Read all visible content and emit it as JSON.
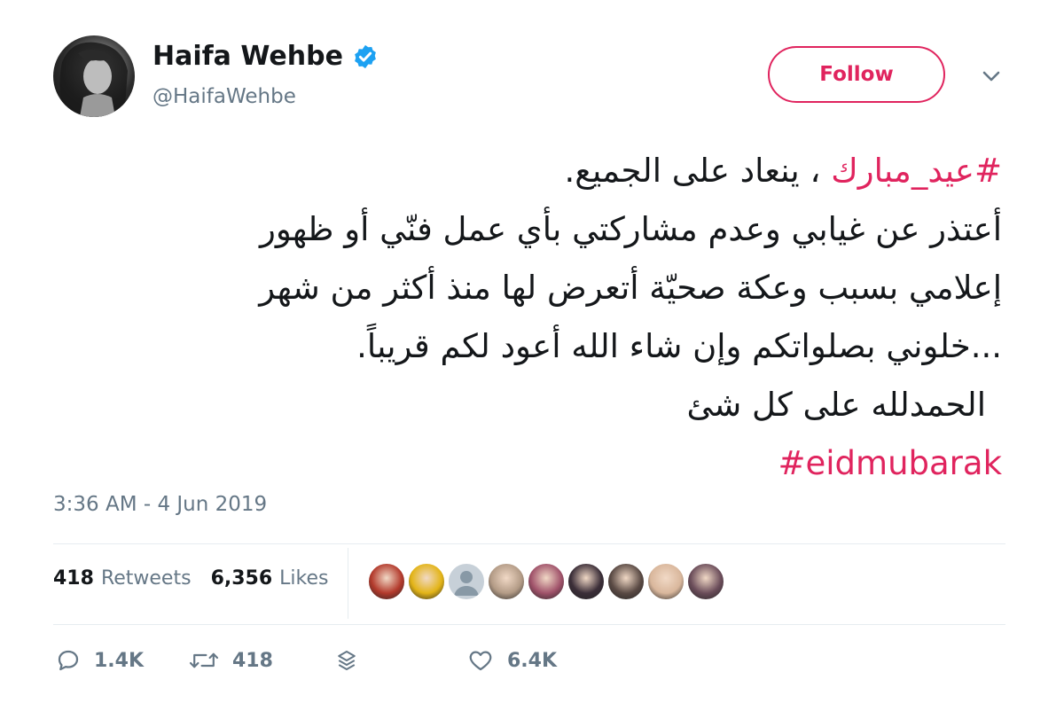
{
  "user": {
    "name": "Haifa Wehbe",
    "handle": "@HaifaWehbe"
  },
  "follow_label": "Follow",
  "tweet": {
    "lines": [
      {
        "hashtag": "#عيد_مبارك",
        "text": " ، ينعاد على الجميع."
      },
      {
        "text": "أعتذر عن غيابي وعدم مشاركتي بأي عمل فنّي أو ظهور"
      },
      {
        "text": "إعلامي بسبب وعكة صحيّة أتعرض لها منذ أكثر من شهر"
      },
      {
        "text": "...خلوني بصلواتكم وإن شاء الله أعود لكم قريباً."
      },
      {
        "text": "الحمدلله على كل شئ"
      },
      {
        "hashtag": "#eidmubarak"
      }
    ]
  },
  "timestamp": "3:36 AM - 4 Jun 2019",
  "stats": {
    "retweets_count": "418",
    "retweets_label": "Retweets",
    "likes_count": "6,356",
    "likes_label": "Likes"
  },
  "likers": [
    {
      "icon": "liker-avatar-1",
      "color": "#b33a2c"
    },
    {
      "icon": "liker-avatar-2",
      "color": "#e3b417"
    },
    {
      "icon": "default-avatar-icon",
      "color": "#c7d0d8"
    },
    {
      "icon": "liker-avatar-4",
      "color": "#b39b86"
    },
    {
      "icon": "liker-avatar-5",
      "color": "#a0526a"
    },
    {
      "icon": "liker-avatar-6",
      "color": "#3b2e38"
    },
    {
      "icon": "liker-avatar-7",
      "color": "#5a4a44"
    },
    {
      "icon": "liker-avatar-8",
      "color": "#d9b79c"
    },
    {
      "icon": "liker-avatar-9",
      "color": "#6b4d5a"
    }
  ],
  "actions": {
    "replies": "1.4K",
    "retweets": "418",
    "likes": "6.4K"
  },
  "colors": {
    "accent": "#e0245e",
    "verified": "#1da1f2",
    "muted": "#657786",
    "text": "#14171a"
  }
}
